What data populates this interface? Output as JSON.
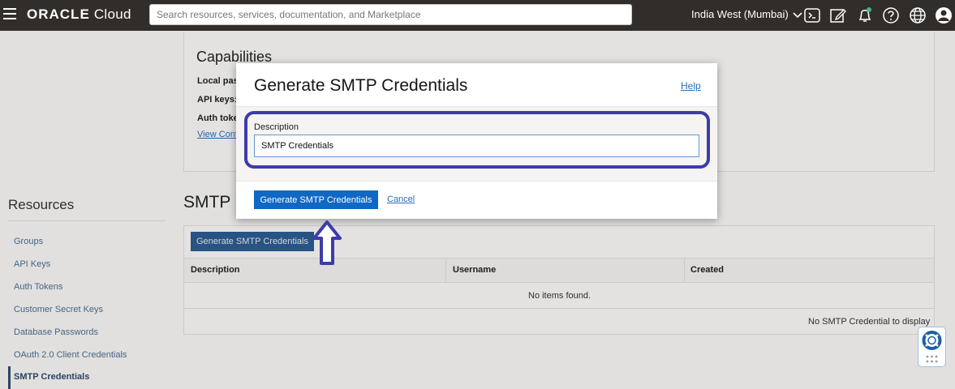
{
  "header": {
    "logo_brand": "ORACLE",
    "logo_product": "Cloud",
    "search_placeholder": "Search resources, services, documentation, and Marketplace",
    "region": "India West (Mumbai)",
    "icons": [
      "menu-icon",
      "cloud-shell-icon",
      "edit-icon",
      "notifications-icon",
      "help-icon",
      "globe-icon",
      "user-icon"
    ]
  },
  "sidebar": {
    "title": "Resources",
    "items": [
      {
        "label": "Groups",
        "active": false
      },
      {
        "label": "API Keys",
        "active": false
      },
      {
        "label": "Auth Tokens",
        "active": false
      },
      {
        "label": "Customer Secret Keys",
        "active": false
      },
      {
        "label": "Database Passwords",
        "active": false
      },
      {
        "label": "OAuth 2.0 Client Credentials",
        "active": false
      },
      {
        "label": "SMTP Credentials",
        "active": true
      }
    ]
  },
  "capabilities": {
    "title": "Capabilities",
    "labels": [
      "Local pas",
      "API keys:",
      "Auth toke"
    ],
    "link": "View Conf"
  },
  "smtp_section": {
    "heading": "SMTP",
    "button_label": "Generate SMTP Credentials",
    "columns": [
      "Description",
      "Username",
      "Created"
    ],
    "empty_message": "No items found.",
    "footer": "No SMTP Credential to display"
  },
  "modal": {
    "title": "Generate SMTP Credentials",
    "help_link": "Help",
    "description_label": "Description",
    "description_value": "SMTP Credentials",
    "primary_button": "Generate SMTP Credentials",
    "cancel_link": "Cancel"
  },
  "colors": {
    "topbar": "#312d2a",
    "primary_button": "#0f68c4",
    "annotation": "#3c3caa",
    "link": "#2a6ebb"
  }
}
